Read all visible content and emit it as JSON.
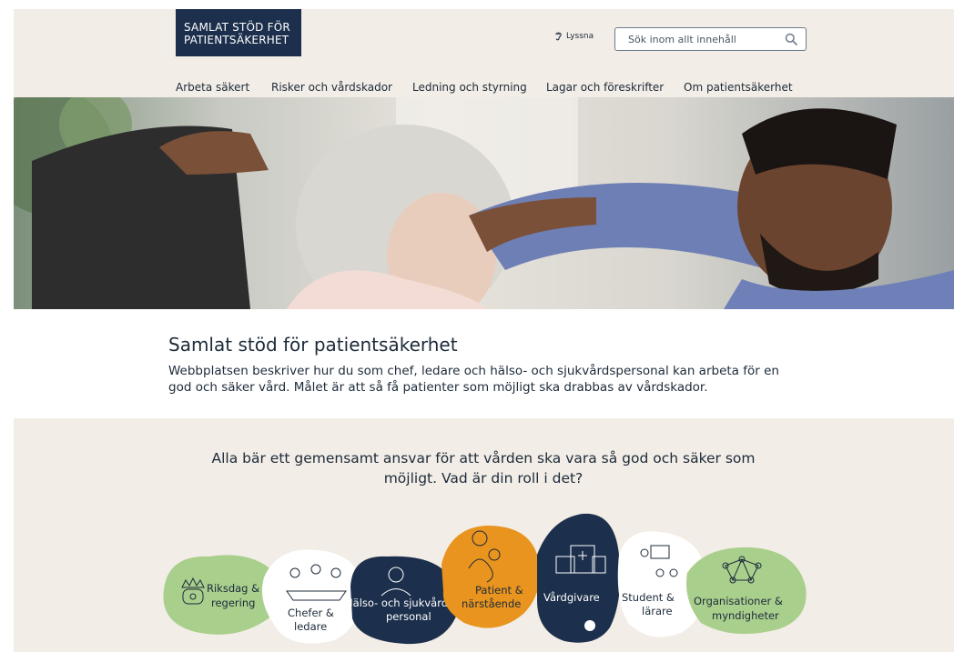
{
  "header": {
    "logo_line1": "SAMLAT STÖD FÖR",
    "logo_line2": "PATIENTSÄKERHET",
    "listen_label": "Lyssna",
    "search_placeholder": "Sök inom allt innehåll"
  },
  "nav": {
    "items": [
      "Arbeta säkert",
      "Risker och vårdskador",
      "Ledning och styrning",
      "Lagar och föreskrifter",
      "Om patientsäkerhet"
    ]
  },
  "intro": {
    "title": "Samlat stöd för patientsäkerhet",
    "text": "Webbplatsen beskriver hur du som chef, ledare och hälso- och sjukvårdspersonal kan arbeta för en god och säker vård. Målet är att så få patienter som möjligt ska drabbas av vårdskador."
  },
  "roles": {
    "heading": "Alla bär ett gemensamt ansvar för att vården ska vara så god och säker som möjligt. Vad är din roll i det?",
    "items": [
      {
        "line1": "Riksdag &",
        "line2": "regering"
      },
      {
        "line1": "Chefer &",
        "line2": "ledare"
      },
      {
        "line1": "Hälso- och sjukvårds-",
        "line2": "personal"
      },
      {
        "line1": "Patient &",
        "line2": "närstående"
      },
      {
        "line1": "Vårdgivare",
        "line2": ""
      },
      {
        "line1": "Student &",
        "line2": "lärare"
      },
      {
        "line1": "Organisationer &",
        "line2": "myndigheter"
      }
    ]
  },
  "colors": {
    "navy": "#1c2f4c",
    "beige": "#f2ede6",
    "green": "#a9cf8d",
    "orange": "#e8941e",
    "white": "#ffffff"
  },
  "icons": [
    "ear-icon",
    "search-icon",
    "crown-icon",
    "meeting-icon",
    "nurse-icon",
    "parent-child-icon",
    "hospital-icon",
    "teacher-icon",
    "network-icon"
  ]
}
